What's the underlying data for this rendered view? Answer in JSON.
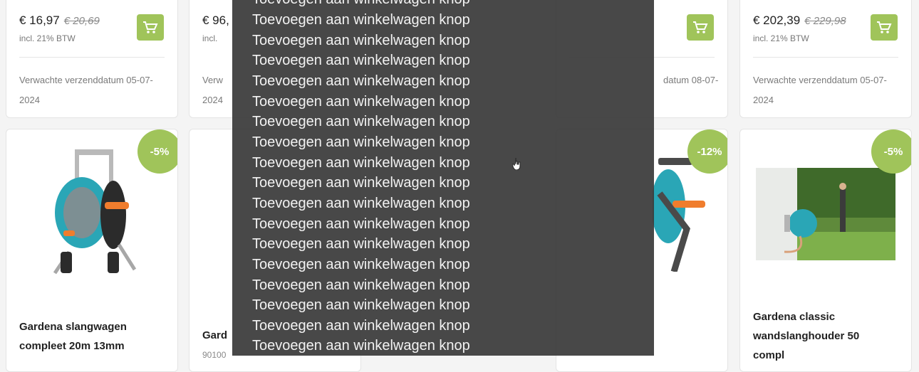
{
  "colors": {
    "accent": "#a0c45a",
    "overlay": "#3a3a3a",
    "text": "#222222"
  },
  "top_row": [
    {
      "price": "€ 16,97",
      "old_price": "€ 20,69",
      "vat": "incl. 21% BTW",
      "ship_line1": "Verwachte verzenddatum 05-07-",
      "ship_line2": "2024"
    },
    {
      "price": "€ 96,",
      "vat": "incl.",
      "ship_line1": "Verw",
      "ship_line2": "2024"
    },
    {
      "ship_line1": "datum 08-07-"
    },
    {
      "price": "€ 202,39",
      "old_price": "€ 229,98",
      "vat": "incl. 21% BTW",
      "ship_line1": "Verwachte verzenddatum 05-07-",
      "ship_line2": "2024"
    }
  ],
  "bottom_row": [
    {
      "badge": "-5%",
      "title_line1": "Gardena slangwagen",
      "title_line2": "compleet 20m 13mm"
    },
    {
      "title_line1": "Gard",
      "sku": "90100"
    },
    {
      "badge": "-12%"
    },
    {
      "badge": "-5%",
      "title_line1": "Gardena classic",
      "title_line2": "wandslanghouder 50",
      "title_line3": "compl"
    }
  ],
  "overlay": {
    "lines": [
      "Toevoegen aan winkelwagen knop",
      "Toevoegen aan winkelwagen knop",
      "Toevoegen aan winkelwagen knop",
      "Toevoegen aan winkelwagen knop",
      "Toevoegen aan winkelwagen knop",
      "Toevoegen aan winkelwagen knop",
      "Toevoegen aan winkelwagen knop",
      "Toevoegen aan winkelwagen knop",
      "Toevoegen aan winkelwagen knop",
      "Toevoegen aan winkelwagen knop",
      "Toevoegen aan winkelwagen knop",
      "Toevoegen aan winkelwagen knop",
      "Toevoegen aan winkelwagen knop",
      "Toevoegen aan winkelwagen knop",
      "Toevoegen aan winkelwagen knop",
      "Toevoegen aan winkelwagen knop",
      "Toevoegen aan winkelwagen knop",
      "Toevoegen aan winkelwagen knop"
    ]
  },
  "icons": {
    "cart": "shopping-cart-icon",
    "cursor": "hand-pointer-icon"
  }
}
